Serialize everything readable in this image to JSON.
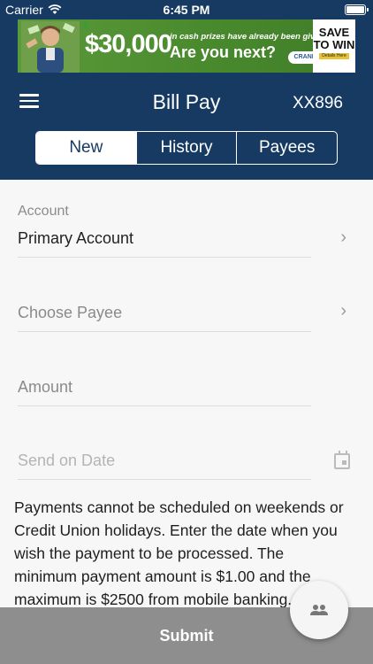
{
  "status_bar": {
    "carrier": "Carrier",
    "time": "6:45 PM"
  },
  "ad": {
    "amount": "$30,000",
    "small_text": "in cash prizes have already been given away!",
    "headline": "Are you next?",
    "brand": "CRANE",
    "save_line1": "SAVE",
    "save_line2": "TO WIN",
    "details": "Details Here",
    "money_symbol": "$"
  },
  "header": {
    "title": "Bill Pay",
    "account": "XX896"
  },
  "tabs": [
    {
      "label": "New",
      "active": true
    },
    {
      "label": "History",
      "active": false
    },
    {
      "label": "Payees",
      "active": false
    }
  ],
  "form": {
    "account_label": "Account",
    "account_value": "Primary Account",
    "payee_placeholder": "Choose Payee",
    "amount_placeholder": "Amount",
    "date_placeholder": "Send on Date",
    "chevron": "›"
  },
  "info_text": "Payments cannot be scheduled on weekends or Credit Union holidays. Enter the date when you wish the payment to be processed. The minimum payment amount is $1.00 and the maximum is $2500 from mobile banking.",
  "submit_label": "Submit",
  "colors": {
    "header": "#173a63",
    "submit_bar": "#8e8e8e",
    "ad_green": "#4a8a2e"
  }
}
